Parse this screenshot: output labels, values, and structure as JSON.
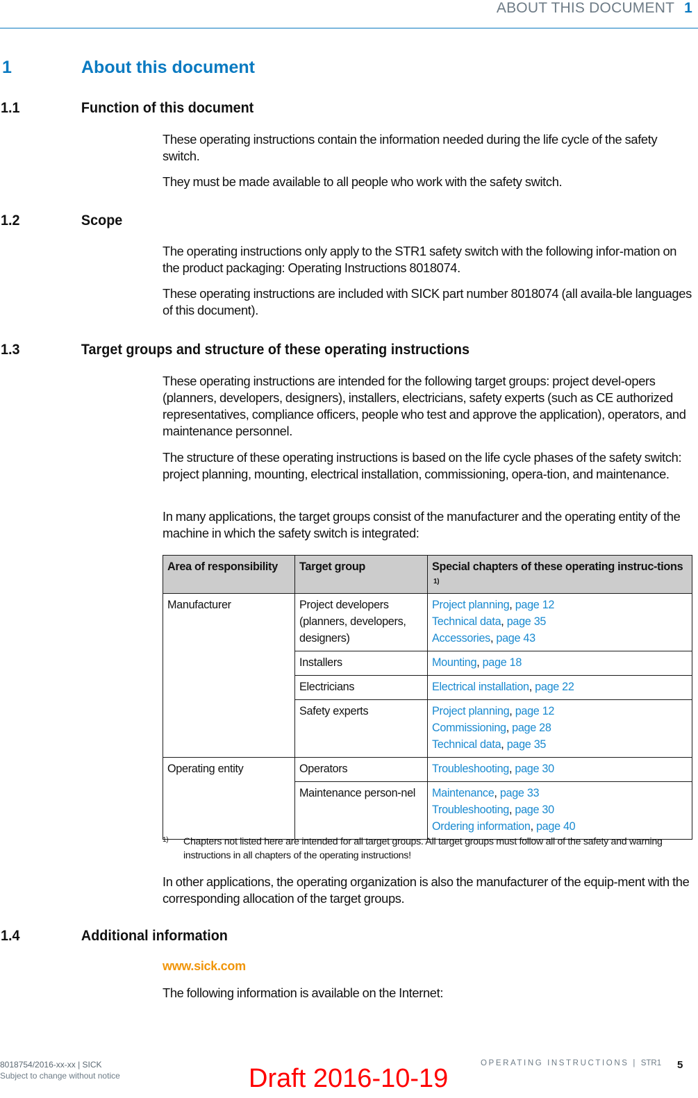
{
  "header": {
    "chapter_title": "ABOUT THIS DOCUMENT",
    "chapter_number": "1",
    "accent_color": "#0a7ac1"
  },
  "chapter": {
    "number": "1",
    "title": "About this document"
  },
  "sections": [
    {
      "number": "1.1",
      "title": "Function of this document",
      "paragraphs": [
        "These operating instructions contain the information needed during the life cycle of the safety switch.",
        "They must be made available to all people who work with the safety switch."
      ]
    },
    {
      "number": "1.2",
      "title": "Scope",
      "paragraphs": [
        "The operating instructions only apply to the STR1 safety switch with the following infor-mation on the product packaging: Operating Instructions 8018074.",
        "These operating instructions are included with SICK part number 8018074 (all availa-ble languages of this document)."
      ]
    },
    {
      "number": "1.3",
      "title": "Target groups and structure of these operating instructions",
      "paragraphs": [
        "These operating instructions are intended for the following target groups: project devel-opers (planners, developers, designers), installers, electricians, safety experts (such as CE authorized representatives, compliance officers, people who test and approve the application), operators, and maintenance personnel.",
        "The structure of these operating instructions is based on the life cycle phases of the safety switch: project planning, mounting, electrical installation, commissioning, opera-tion, and maintenance.",
        "In many applications, the target groups consist of the manufacturer and the operating entity of the machine in which the safety switch is integrated:",
        "In other applications, the operating organization is also the manufacturer of the equip-ment with the corresponding allocation of the target groups."
      ]
    },
    {
      "number": "1.4",
      "title": "Additional information",
      "link": "www.sick.com",
      "paragraphs": [
        "The following information is available on the Internet:"
      ]
    }
  ],
  "table": {
    "headers": [
      "Area of responsibility",
      "Target group",
      "Special chapters of these operating instruc-tions"
    ],
    "header_footnote_mark": "1)",
    "groups": [
      {
        "area": "Manufacturer",
        "rows": [
          {
            "target": "Project developers (planners, developers, designers)",
            "chapters": [
              {
                "title": "Project planning",
                "page": "page 12"
              },
              {
                "title": "Technical data",
                "page": "page 35"
              },
              {
                "title": "Accessories",
                "page": "page 43"
              }
            ]
          },
          {
            "target": "Installers",
            "chapters": [
              {
                "title": "Mounting",
                "page": "page 18"
              }
            ]
          },
          {
            "target": "Electricians",
            "chapters": [
              {
                "title": "Electrical installation",
                "page": "page 22"
              }
            ]
          },
          {
            "target": "Safety experts",
            "chapters": [
              {
                "title": "Project planning",
                "page": "page 12"
              },
              {
                "title": "Commissioning",
                "page": "page 28"
              },
              {
                "title": "Technical data",
                "page": "page 35"
              }
            ]
          }
        ]
      },
      {
        "area": "Operating entity",
        "rows": [
          {
            "target": "Operators",
            "chapters": [
              {
                "title": "Troubleshooting",
                "page": "page 30"
              }
            ]
          },
          {
            "target": "Maintenance person-nel",
            "chapters": [
              {
                "title": "Maintenance",
                "page": "page 33"
              },
              {
                "title": "Troubleshooting",
                "page": "page 30"
              },
              {
                "title": "Ordering information",
                "page": "page 40"
              }
            ]
          }
        ]
      }
    ],
    "footnote": {
      "mark": "1)",
      "text": "Chapters not listed here are intended for all target groups. All target groups must follow all of the safety and warning instructions in all chapters of the operating instructions!"
    },
    "link_color": "#1a8ad0"
  },
  "footer": {
    "doc_id": "8018754/2016-xx-xx | SICK",
    "notice": "Subject to change without notice",
    "doc_type": "OPERATING INSTRUCTIONS | ",
    "product": "STR1",
    "page_number": "5",
    "draft_stamp": "Draft 2016-10-19",
    "draft_color": "#ff0000"
  }
}
